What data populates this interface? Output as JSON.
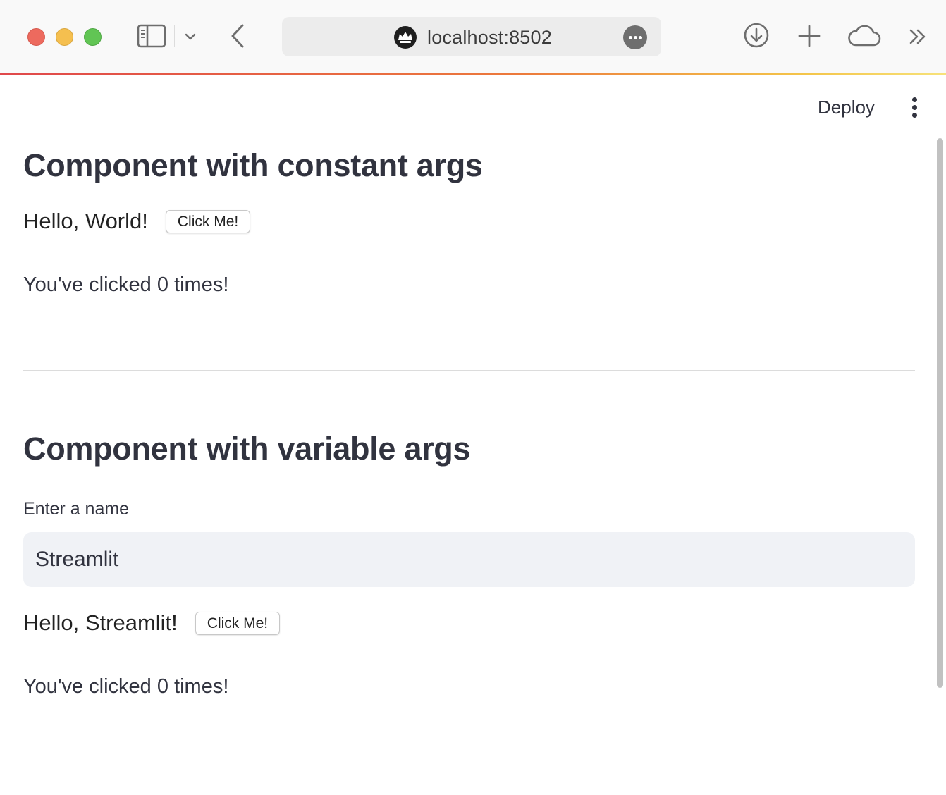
{
  "browser": {
    "url": "localhost:8502",
    "icons": {
      "sidebar": "sidebar-icon",
      "tab_menu": "chevron-down-icon",
      "back": "back-icon",
      "site": "streamlit-crown-icon",
      "url_more": "more-icon",
      "download": "download-icon",
      "new_tab": "plus-icon",
      "cloud": "cloud-icon",
      "overflow": "chevron-double-right-icon"
    }
  },
  "header": {
    "deploy_label": "Deploy",
    "menu_icon": "kebab-menu-icon"
  },
  "sections": [
    {
      "title": "Component with constant args",
      "greeting": "Hello, World!",
      "button_label": "Click Me!",
      "clicked_text": "You've clicked 0 times!"
    },
    {
      "title": "Component with variable args",
      "input": {
        "label": "Enter a name",
        "value": "Streamlit"
      },
      "greeting": "Hello, Streamlit!",
      "button_label": "Click Me!",
      "clicked_text": "You've clicked 0 times!"
    }
  ],
  "colors": {
    "text": "#31333f",
    "input_bg": "#f0f2f6",
    "progress_start": "#e0484b",
    "progress_end": "#f7e27a"
  }
}
